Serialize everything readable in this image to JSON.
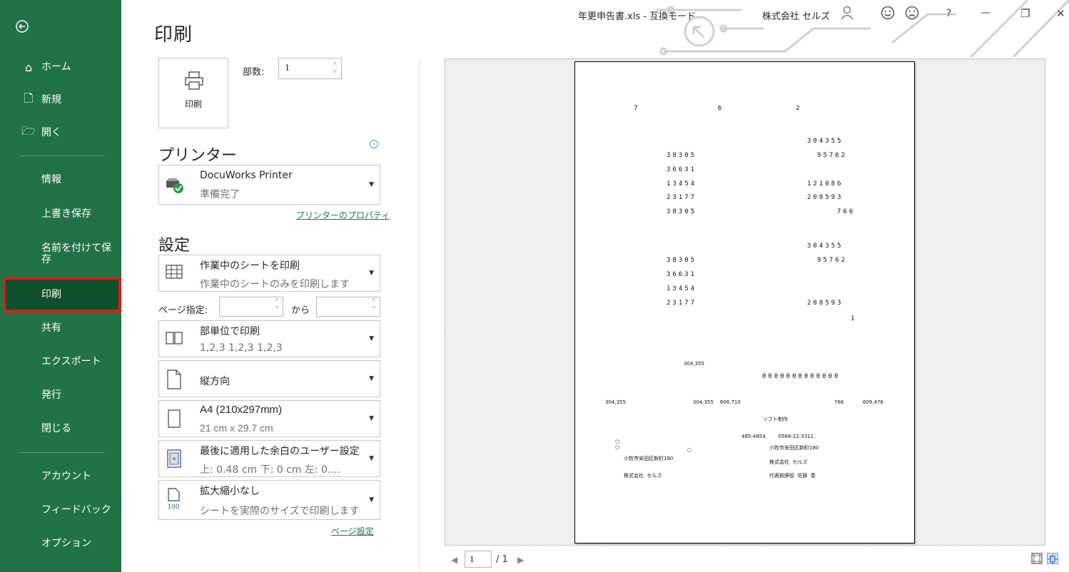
{
  "app": {
    "title": "年更申告書.xls  -  互換モード",
    "company": "株式会社 セルズ",
    "help_label": "?",
    "minimize_label": "—",
    "restore_label": "❐",
    "close_label": "✕"
  },
  "sidebar": {
    "back_icon": "back-arrow-icon",
    "items": [
      {
        "label": "ホーム",
        "icon": "home-icon"
      },
      {
        "label": "新規",
        "icon": "new-document-icon"
      },
      {
        "label": "開く",
        "icon": "open-folder-icon"
      },
      {
        "label": "情報"
      },
      {
        "label": "上書き保存"
      },
      {
        "label": "名前を付けて保\n存"
      },
      {
        "label": "印刷",
        "selected": true
      },
      {
        "label": "共有"
      },
      {
        "label": "エクスポート"
      },
      {
        "label": "発行"
      },
      {
        "label": "閉じる"
      },
      {
        "label": "アカウント"
      },
      {
        "label": "フィードバック"
      },
      {
        "label": "オプション"
      }
    ]
  },
  "print": {
    "heading": "印刷",
    "print_button_label": "印刷",
    "copies_label": "部数:",
    "copies_value": "1",
    "printer_section": "プリンター",
    "printer_name": "DocuWorks Printer",
    "printer_status": "準備完了",
    "printer_properties_link": "プリンターのプロパティ",
    "settings_section": "設定",
    "scope_main": "作業中のシートを印刷",
    "scope_sub": "作業中のシートのみを印刷します",
    "pages_label": "ページ指定:",
    "pages_to": "から",
    "pages_from_value": "",
    "pages_to_value": "",
    "collate_main": "部単位で印刷",
    "collate_sub": "1,2,3    1,2,3    1,2,3",
    "orientation": "縦方向",
    "paper_main": "A4 (210x297mm)",
    "paper_sub": "21 cm x 29.7 cm",
    "margins_main": "最後に適用した余白のユーザー設定",
    "margins_sub": "上: 0.48 cm 下: 0 cm 左: 0.…",
    "scaling_main": "拡大縮小なし",
    "scaling_sub": "シートを実際のサイズで印刷します",
    "scaling_icon_text": "100",
    "page_setup_link": "ページ設定"
  },
  "preview": {
    "lines": [
      {
        "text": "7             6            2"
      },
      {
        "text": "304355"
      },
      {
        "text": "38305"
      },
      {
        "text": "95762"
      },
      {
        "text": "36631"
      },
      {
        "text": "13454"
      },
      {
        "text": "121086"
      },
      {
        "text": "23177"
      },
      {
        "text": "208593"
      },
      {
        "text": "38305"
      },
      {
        "text": "766"
      },
      {
        "text": "304355"
      },
      {
        "text": "38305"
      },
      {
        "text": "95762"
      },
      {
        "text": "36631"
      },
      {
        "text": "13454"
      },
      {
        "text": "23177"
      },
      {
        "text": "208593"
      },
      {
        "text": "1"
      },
      {
        "text": "0000000000000"
      }
    ],
    "small": [
      {
        "text": "304,355"
      },
      {
        "text": "304,355"
      },
      {
        "text": "304,355    608,710"
      },
      {
        "text": "766"
      },
      {
        "text": "609,476"
      },
      {
        "text": "ソフト制作"
      },
      {
        "text": "485-4854        0568-22-3311"
      },
      {
        "text": "小牧市安田区新町180"
      },
      {
        "text": "小牧市安田区新町180"
      },
      {
        "text": "株式会社  セルズ"
      },
      {
        "text": "株式会社  セルズ"
      },
      {
        "text": "代表取締役  佐藤  豊"
      },
      {
        "text": "○"
      },
      {
        "text": "○"
      },
      {
        "text": "○"
      }
    ]
  },
  "pager": {
    "current": "1",
    "total": "/ 1"
  }
}
